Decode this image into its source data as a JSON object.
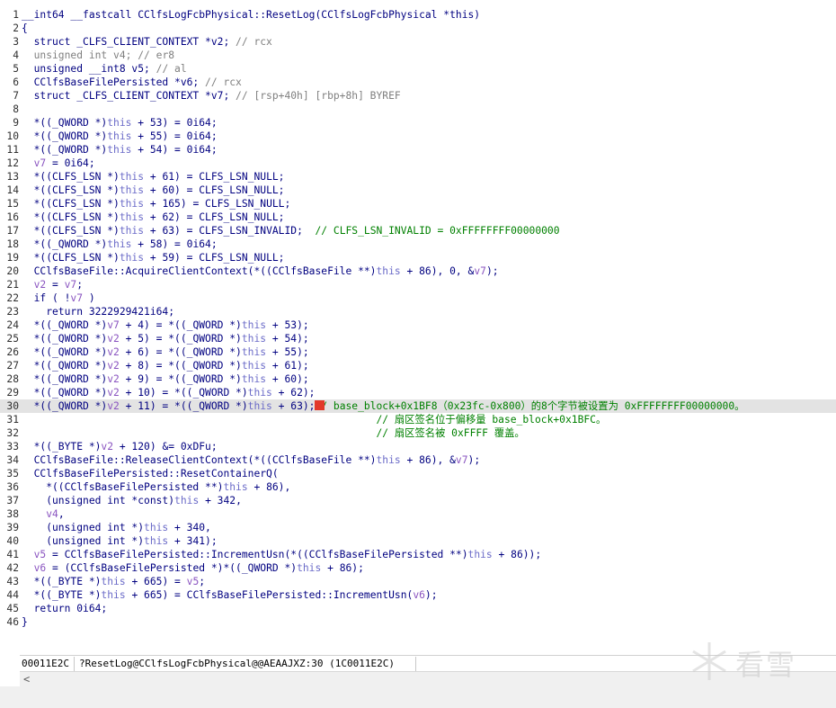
{
  "lines": [
    {
      "n": "1",
      "segs": [
        [
          "",
          "__int64 __fastcall CClfsLogFcbPhysical::ResetLog(CClfsLogFcbPhysical *this)"
        ]
      ]
    },
    {
      "n": "2",
      "segs": [
        [
          "",
          "{"
        ]
      ]
    },
    {
      "n": "3",
      "segs": [
        [
          "",
          "  struct _CLFS_CLIENT_CONTEXT *v2; "
        ],
        [
          "c",
          "// rcx"
        ]
      ]
    },
    {
      "n": "4",
      "segs": [
        [
          "g",
          "  unsigned int v4; "
        ],
        [
          "c",
          "// er8"
        ]
      ]
    },
    {
      "n": "5",
      "segs": [
        [
          "",
          "  unsigned __int8 v5; "
        ],
        [
          "c",
          "// al"
        ]
      ]
    },
    {
      "n": "6",
      "segs": [
        [
          "",
          "  CClfsBaseFilePersisted *v6; "
        ],
        [
          "c",
          "// rcx"
        ]
      ]
    },
    {
      "n": "7",
      "segs": [
        [
          "",
          "  struct _CLFS_CLIENT_CONTEXT *v7; "
        ],
        [
          "c",
          "// [rsp+40h] [rbp+8h] BYREF"
        ]
      ]
    },
    {
      "n": "8",
      "segs": [
        [
          "",
          ""
        ]
      ]
    },
    {
      "n": "9",
      "segs": [
        [
          "",
          "  *((_QWORD *)"
        ],
        [
          "t",
          "this"
        ],
        [
          "",
          " + 53) = 0i64;"
        ]
      ]
    },
    {
      "n": "10",
      "segs": [
        [
          "",
          "  *((_QWORD *)"
        ],
        [
          "t",
          "this"
        ],
        [
          "",
          " + 55) = 0i64;"
        ]
      ]
    },
    {
      "n": "11",
      "segs": [
        [
          "",
          "  *((_QWORD *)"
        ],
        [
          "t",
          "this"
        ],
        [
          "",
          " + 54) = 0i64;"
        ]
      ]
    },
    {
      "n": "12",
      "segs": [
        [
          "v",
          "  v7"
        ],
        [
          "",
          " = 0i64;"
        ]
      ]
    },
    {
      "n": "13",
      "segs": [
        [
          "",
          "  *((CLFS_LSN *)"
        ],
        [
          "t",
          "this"
        ],
        [
          "",
          " + 61) = CLFS_LSN_NULL;"
        ]
      ]
    },
    {
      "n": "14",
      "segs": [
        [
          "",
          "  *((CLFS_LSN *)"
        ],
        [
          "t",
          "this"
        ],
        [
          "",
          " + 60) = CLFS_LSN_NULL;"
        ]
      ]
    },
    {
      "n": "15",
      "segs": [
        [
          "",
          "  *((CLFS_LSN *)"
        ],
        [
          "t",
          "this"
        ],
        [
          "",
          " + 165) = CLFS_LSN_NULL;"
        ]
      ]
    },
    {
      "n": "16",
      "segs": [
        [
          "",
          "  *((CLFS_LSN *)"
        ],
        [
          "t",
          "this"
        ],
        [
          "",
          " + 62) = CLFS_LSN_NULL;"
        ]
      ]
    },
    {
      "n": "17",
      "segs": [
        [
          "",
          "  *((CLFS_LSN *)"
        ],
        [
          "t",
          "this"
        ],
        [
          "",
          " + 63) = CLFS_LSN_INVALID;  "
        ],
        [
          "cm",
          "// CLFS_LSN_INVALID = 0xFFFFFFFF00000000"
        ]
      ]
    },
    {
      "n": "18",
      "segs": [
        [
          "",
          "  *((_QWORD *)"
        ],
        [
          "t",
          "this"
        ],
        [
          "",
          " + 58) = 0i64;"
        ]
      ]
    },
    {
      "n": "19",
      "segs": [
        [
          "",
          "  *((CLFS_LSN *)"
        ],
        [
          "t",
          "this"
        ],
        [
          "",
          " + 59) = CLFS_LSN_NULL;"
        ]
      ]
    },
    {
      "n": "20",
      "segs": [
        [
          "",
          "  CClfsBaseFile::AcquireClientContext(*((CClfsBaseFile **)"
        ],
        [
          "t",
          "this"
        ],
        [
          "",
          " + 86), 0, &"
        ],
        [
          "v",
          "v7"
        ],
        [
          "",
          ");"
        ]
      ]
    },
    {
      "n": "21",
      "segs": [
        [
          "v",
          "  v2"
        ],
        [
          "",
          " = "
        ],
        [
          "v",
          "v7"
        ],
        [
          "",
          ";"
        ]
      ]
    },
    {
      "n": "22",
      "segs": [
        [
          "",
          "  if ( !"
        ],
        [
          "v",
          "v7"
        ],
        [
          "",
          " )"
        ]
      ]
    },
    {
      "n": "23",
      "segs": [
        [
          "",
          "    return 3222929421i64;"
        ]
      ]
    },
    {
      "n": "24",
      "segs": [
        [
          "",
          "  *((_QWORD *)"
        ],
        [
          "v",
          "v7"
        ],
        [
          "",
          " + 4) = *((_QWORD *)"
        ],
        [
          "t",
          "this"
        ],
        [
          "",
          " + 53);"
        ]
      ]
    },
    {
      "n": "25",
      "segs": [
        [
          "",
          "  *((_QWORD *)"
        ],
        [
          "v",
          "v2"
        ],
        [
          "",
          " + 5) = *((_QWORD *)"
        ],
        [
          "t",
          "this"
        ],
        [
          "",
          " + 54);"
        ]
      ]
    },
    {
      "n": "26",
      "segs": [
        [
          "",
          "  *((_QWORD *)"
        ],
        [
          "v",
          "v2"
        ],
        [
          "",
          " + 6) = *((_QWORD *)"
        ],
        [
          "t",
          "this"
        ],
        [
          "",
          " + 55);"
        ]
      ]
    },
    {
      "n": "27",
      "segs": [
        [
          "",
          "  *((_QWORD *)"
        ],
        [
          "v",
          "v2"
        ],
        [
          "",
          " + 8) = *((_QWORD *)"
        ],
        [
          "t",
          "this"
        ],
        [
          "",
          " + 61);"
        ]
      ]
    },
    {
      "n": "28",
      "segs": [
        [
          "",
          "  *((_QWORD *)"
        ],
        [
          "v",
          "v2"
        ],
        [
          "",
          " + 9) = *((_QWORD *)"
        ],
        [
          "t",
          "this"
        ],
        [
          "",
          " + 60);"
        ]
      ]
    },
    {
      "n": "29",
      "segs": [
        [
          "",
          "  *((_QWORD *)"
        ],
        [
          "v",
          "v2"
        ],
        [
          "",
          " + 10) = *((_QWORD *)"
        ],
        [
          "t",
          "this"
        ],
        [
          "",
          " + 62);"
        ]
      ]
    },
    {
      "n": "30",
      "hl": true,
      "segs": [
        [
          "",
          "  *((_QWORD *)"
        ],
        [
          "v",
          "v2"
        ],
        [
          "",
          " + 11) = *((_QWORD *)"
        ],
        [
          "t",
          "this"
        ],
        [
          "",
          " + 63);"
        ],
        [
          "cm",
          "// base_block+0x1BF8（0x23fc-0x800）的8个字节被设置为 0xFFFFFFFF00000000。"
        ]
      ]
    },
    {
      "n": "31",
      "segs": [
        [
          "cm",
          "                                                          // 扇区签名位于偏移量 base_block+0x1BFC。"
        ]
      ]
    },
    {
      "n": "32",
      "segs": [
        [
          "cm",
          "                                                          // 扇区签名被 0xFFFF 覆盖。"
        ]
      ]
    },
    {
      "n": "33",
      "segs": [
        [
          "",
          "  *((_BYTE *)"
        ],
        [
          "v",
          "v2"
        ],
        [
          "",
          " + 120) &= 0xDFu;"
        ]
      ]
    },
    {
      "n": "34",
      "segs": [
        [
          "",
          "  CClfsBaseFile::ReleaseClientContext(*((CClfsBaseFile **)"
        ],
        [
          "t",
          "this"
        ],
        [
          "",
          " + 86), &"
        ],
        [
          "v",
          "v7"
        ],
        [
          "",
          ");"
        ]
      ]
    },
    {
      "n": "35",
      "segs": [
        [
          "",
          "  CClfsBaseFilePersisted::ResetContainerQ("
        ]
      ]
    },
    {
      "n": "36",
      "segs": [
        [
          "",
          "    *((CClfsBaseFilePersisted **)"
        ],
        [
          "t",
          "this"
        ],
        [
          "",
          " + 86),"
        ]
      ]
    },
    {
      "n": "37",
      "segs": [
        [
          "",
          "    (unsigned int *const)"
        ],
        [
          "t",
          "this"
        ],
        [
          "",
          " + 342,"
        ]
      ]
    },
    {
      "n": "38",
      "segs": [
        [
          "v",
          "    v4"
        ],
        [
          "",
          ","
        ]
      ]
    },
    {
      "n": "39",
      "segs": [
        [
          "",
          "    (unsigned int *)"
        ],
        [
          "t",
          "this"
        ],
        [
          "",
          " + 340,"
        ]
      ]
    },
    {
      "n": "40",
      "segs": [
        [
          "",
          "    (unsigned int *)"
        ],
        [
          "t",
          "this"
        ],
        [
          "",
          " + 341);"
        ]
      ]
    },
    {
      "n": "41",
      "segs": [
        [
          "v",
          "  v5"
        ],
        [
          "",
          " = CClfsBaseFilePersisted::IncrementUsn(*((CClfsBaseFilePersisted **)"
        ],
        [
          "t",
          "this"
        ],
        [
          "",
          " + 86));"
        ]
      ]
    },
    {
      "n": "42",
      "segs": [
        [
          "v",
          "  v6"
        ],
        [
          "",
          " = (CClfsBaseFilePersisted *)*((_QWORD *)"
        ],
        [
          "t",
          "this"
        ],
        [
          "",
          " + 86);"
        ]
      ]
    },
    {
      "n": "43",
      "segs": [
        [
          "",
          "  *((_BYTE *)"
        ],
        [
          "t",
          "this"
        ],
        [
          "",
          " + 665) = "
        ],
        [
          "v",
          "v5"
        ],
        [
          "",
          ";"
        ]
      ]
    },
    {
      "n": "44",
      "segs": [
        [
          "",
          "  *((_BYTE *)"
        ],
        [
          "t",
          "this"
        ],
        [
          "",
          " + 665) = CClfsBaseFilePersisted::IncrementUsn("
        ],
        [
          "v",
          "v6"
        ],
        [
          "",
          ");"
        ]
      ]
    },
    {
      "n": "45",
      "segs": [
        [
          "",
          "  return 0i64;"
        ]
      ]
    },
    {
      "n": "46",
      "segs": [
        [
          "",
          "}"
        ]
      ]
    }
  ],
  "status": {
    "address": "00011E2C",
    "location": "?ResetLog@CClfsLogFcbPhysical@@AEAAJXZ:30 (1C0011E2C)"
  },
  "watermark": {
    "text": "看雪"
  },
  "scroll_left_arrow": "<"
}
